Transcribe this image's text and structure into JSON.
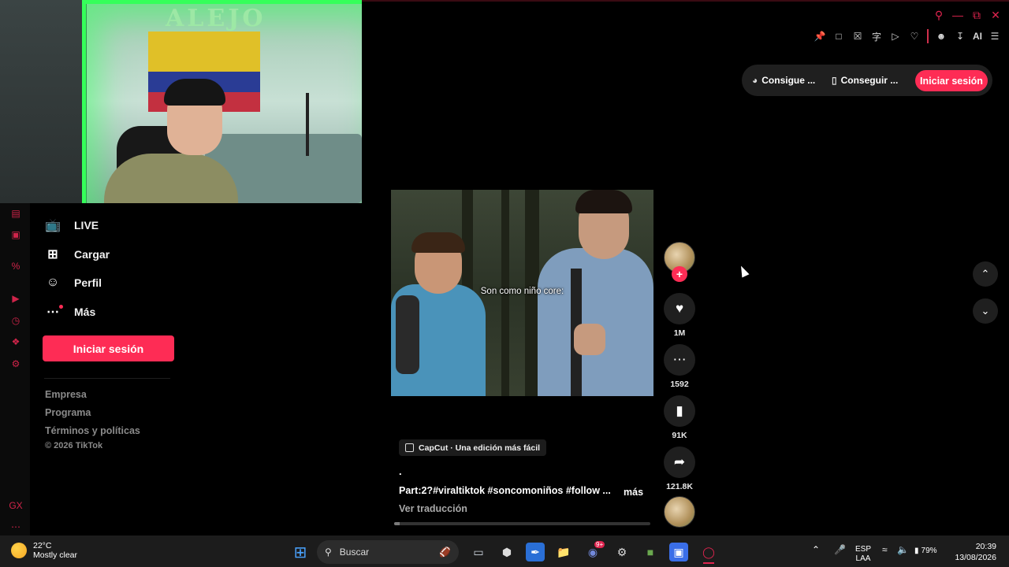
{
  "webcam": {
    "sign_text": "ALEJO"
  },
  "browser": {
    "window_controls": [
      "search-icon",
      "minimize-icon",
      "restore-icon",
      "close-icon"
    ],
    "toolbar_ai_label": "AI"
  },
  "tiktok_nav": {
    "items": [
      {
        "label": "LIVE",
        "icon": "live-tv-icon"
      },
      {
        "label": "Cargar",
        "icon": "upload-plus-icon"
      },
      {
        "label": "Perfil",
        "icon": "person-icon"
      },
      {
        "label": "Más",
        "icon": "more-dots-icon"
      }
    ],
    "login_label": "Iniciar sesión",
    "footer_links": [
      "Empresa",
      "Programa",
      "Términos y políticas"
    ],
    "copyright": "© 2026 TikTok"
  },
  "header": {
    "link1": "Consigue ...",
    "link2": "Conseguir ...",
    "login_label": "Iniciar sesión"
  },
  "video": {
    "caption_overlay": "Son como niño core:",
    "capcut_label": "CapCut · Una edición más fácil",
    "dot_line": ".",
    "description": "Part:2?#viraltiktok #soncomoniños #follow ...",
    "more_label": "más",
    "translate_label": "Ver traducción",
    "progress_fraction": 0.02
  },
  "actions": {
    "likes": "1M",
    "comments": "1592",
    "saves": "91K",
    "shares": "121.8K"
  },
  "taskbar": {
    "temp": "22°C",
    "weather_desc": "Mostly clear",
    "search_placeholder": "Buscar",
    "lang_top": "ESP",
    "lang_bottom": "LAA",
    "battery": "79%",
    "time": "20:39",
    "date": "13/08/2026",
    "discord_badge": "9+"
  },
  "colors": {
    "tiktok_accent": "#fe2c55",
    "opera_accent": "#e0244f",
    "background": "#000000"
  }
}
